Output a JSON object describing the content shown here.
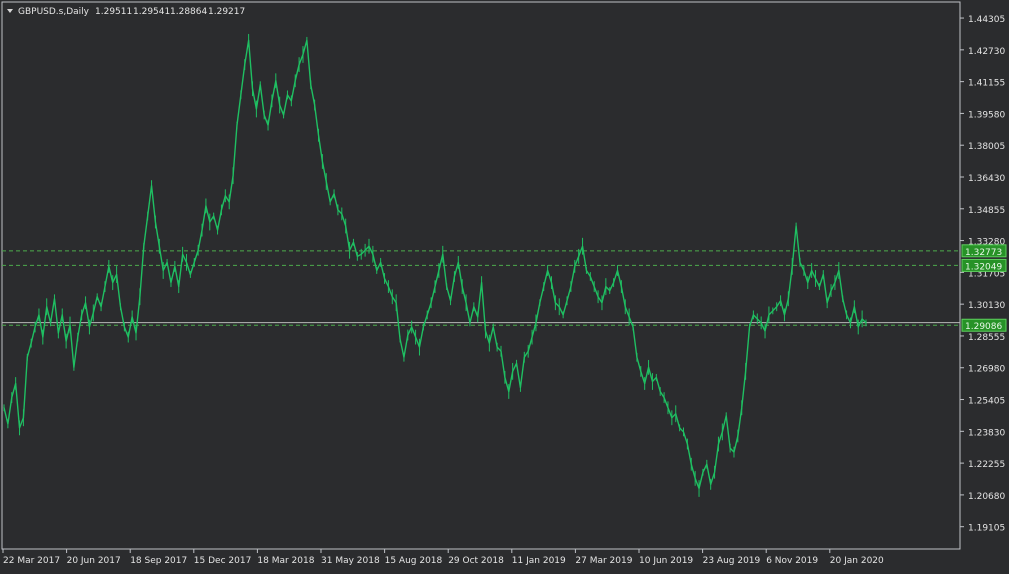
{
  "header": {
    "collapse_icon": "triangle-down-icon",
    "symbol": "GBPUSD.s,Daily",
    "ohlc": [
      "1.29511",
      "1.29541",
      "1.28864",
      "1.29217"
    ]
  },
  "chart_data": {
    "type": "line",
    "title": "GBPUSD.s,Daily",
    "ylim": [
      1.18,
      1.451
    ],
    "y_ticks": [
      "1.44305",
      "1.42730",
      "1.41155",
      "1.39580",
      "1.38005",
      "1.36430",
      "1.34855",
      "1.33280",
      "1.31705",
      "1.30130",
      "1.28555",
      "1.26980",
      "1.25405",
      "1.23830",
      "1.22255",
      "1.20680",
      "1.19105"
    ],
    "x_ticks": [
      "22 Mar 2017",
      "20 Jun 2017",
      "18 Sep 2017",
      "15 Dec 2017",
      "18 Mar 2018",
      "31 May 2018",
      "15 Aug 2018",
      "29 Oct 2018",
      "11 Jan 2019",
      "27 Mar 2019",
      "10 Jun 2019",
      "23 Aug 2019",
      "6 Nov 2019",
      "20 Jan 2020"
    ],
    "series": [
      {
        "values": [
          1.25,
          1.242,
          1.255,
          1.262,
          1.24,
          1.245,
          1.275,
          1.282,
          1.29,
          1.296,
          1.285,
          1.3,
          1.292,
          1.304,
          1.287,
          1.296,
          1.283,
          1.291,
          1.27,
          1.285,
          1.296,
          1.302,
          1.29,
          1.297,
          1.305,
          1.3,
          1.31,
          1.32,
          1.312,
          1.316,
          1.3,
          1.29,
          1.285,
          1.295,
          1.287,
          1.305,
          1.33,
          1.345,
          1.36,
          1.342,
          1.33,
          1.318,
          1.322,
          1.312,
          1.32,
          1.31,
          1.326,
          1.322,
          1.316,
          1.322,
          1.328,
          1.338,
          1.35,
          1.342,
          1.345,
          1.338,
          1.348,
          1.355,
          1.352,
          1.365,
          1.39,
          1.405,
          1.42,
          1.432,
          1.408,
          1.398,
          1.41,
          1.395,
          1.39,
          1.402,
          1.412,
          1.4,
          1.395,
          1.405,
          1.402,
          1.412,
          1.42,
          1.425,
          1.432,
          1.41,
          1.4,
          1.385,
          1.372,
          1.362,
          1.352,
          1.356,
          1.348,
          1.346,
          1.34,
          1.328,
          1.332,
          1.325,
          1.326,
          1.328,
          1.33,
          1.326,
          1.318,
          1.322,
          1.314,
          1.31,
          1.305,
          1.302,
          1.284,
          1.275,
          1.286,
          1.29,
          1.285,
          1.28,
          1.29,
          1.296,
          1.302,
          1.31,
          1.318,
          1.326,
          1.31,
          1.303,
          1.315,
          1.322,
          1.31,
          1.302,
          1.292,
          1.3,
          1.295,
          1.312,
          1.288,
          1.282,
          1.29,
          1.28,
          1.278,
          1.265,
          1.258,
          1.268,
          1.272,
          1.26,
          1.275,
          1.278,
          1.285,
          1.292,
          1.302,
          1.31,
          1.318,
          1.312,
          1.302,
          1.3,
          1.296,
          1.303,
          1.31,
          1.32,
          1.325,
          1.33,
          1.318,
          1.315,
          1.31,
          1.305,
          1.302,
          1.31,
          1.308,
          1.312,
          1.318,
          1.31,
          1.3,
          1.295,
          1.29,
          1.275,
          1.268,
          1.262,
          1.27,
          1.263,
          1.265,
          1.258,
          1.255,
          1.25,
          1.245,
          1.247,
          1.24,
          1.238,
          1.232,
          1.222,
          1.215,
          1.21,
          1.218,
          1.222,
          1.212,
          1.218,
          1.232,
          1.238,
          1.246,
          1.23,
          1.228,
          1.236,
          1.25,
          1.268,
          1.29,
          1.296,
          1.294,
          1.292,
          1.288,
          1.296,
          1.298,
          1.3,
          1.303,
          1.296,
          1.304,
          1.32,
          1.34,
          1.322,
          1.318,
          1.312,
          1.318,
          1.314,
          1.31,
          1.316,
          1.302,
          1.308,
          1.312,
          1.318,
          1.304,
          1.296,
          1.292,
          1.3,
          1.29,
          1.294,
          1.292
        ]
      }
    ],
    "horizontal_levels": [
      {
        "label": "1.32773",
        "value": 1.32773,
        "style": "dashed"
      },
      {
        "label": "1.32049",
        "value": 1.32049,
        "style": "dashed"
      },
      {
        "label": "1.29086",
        "value": 1.29086,
        "style": "dashed"
      },
      {
        "value": 1.29217,
        "style": "solid"
      }
    ],
    "grid": false,
    "colors": {
      "background": "#2b2c2e",
      "line": "#1fbf62",
      "axis": "#bfc2c7",
      "text": "#e4e4e4",
      "level": "#4cab4c",
      "current": "#b8b8b8",
      "label_bg": "#279227"
    }
  }
}
